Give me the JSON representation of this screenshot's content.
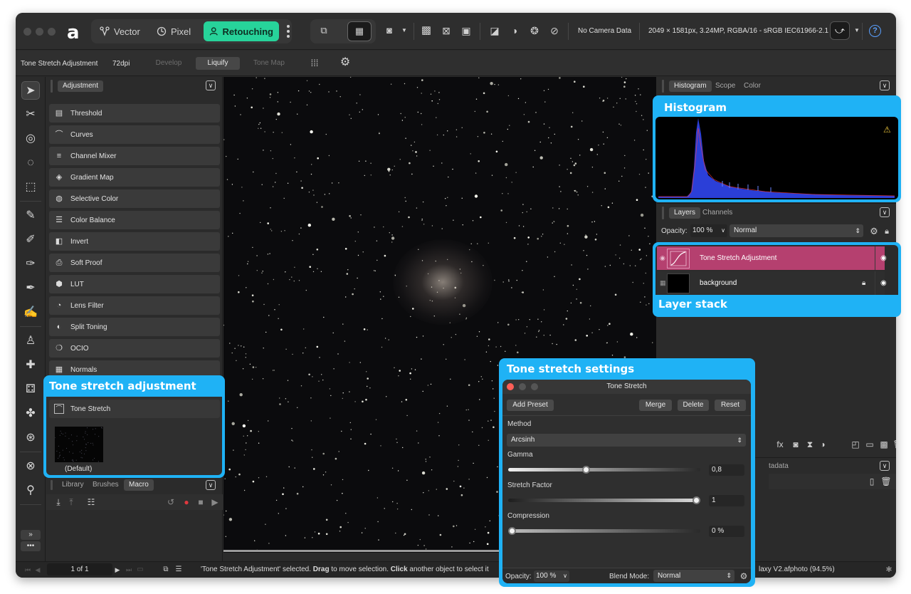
{
  "toolbar": {
    "personas": [
      {
        "label": "Vector",
        "icon": "vector-icon"
      },
      {
        "label": "Pixel",
        "icon": "pixel-icon"
      },
      {
        "label": "Retouching",
        "icon": "person-icon",
        "active": true
      }
    ],
    "camera_info": "No Camera Data",
    "document_info": "2049 × 1581px, 3.24MP, RGBA/16 - sRGB IEC61966-2.1",
    "help": "?"
  },
  "context": {
    "tool_name": "Tone Stretch Adjustment",
    "dpi": "72dpi",
    "buttons": [
      "Develop",
      "Liquify",
      "Tone Map"
    ],
    "active_button": "Liquify"
  },
  "adjustment_panel": {
    "tab": "Adjustment",
    "items": [
      {
        "label": "Threshold",
        "icon": "threshold-icon"
      },
      {
        "label": "Curves",
        "icon": "curves-icon"
      },
      {
        "label": "Channel Mixer",
        "icon": "channel-mixer-icon"
      },
      {
        "label": "Gradient Map",
        "icon": "gradient-map-icon"
      },
      {
        "label": "Selective Color",
        "icon": "selective-color-icon"
      },
      {
        "label": "Color Balance",
        "icon": "color-balance-icon"
      },
      {
        "label": "Invert",
        "icon": "invert-icon"
      },
      {
        "label": "Soft Proof",
        "icon": "printer-icon"
      },
      {
        "label": "LUT",
        "icon": "cube-icon"
      },
      {
        "label": "Lens Filter",
        "icon": "lens-filter-icon"
      },
      {
        "label": "Split Toning",
        "icon": "split-toning-icon"
      },
      {
        "label": "OCIO",
        "icon": "ocio-icon"
      },
      {
        "label": "Normals",
        "icon": "normals-icon"
      }
    ],
    "preset": {
      "label": "Tone Stretch",
      "default_label": "(Default)"
    }
  },
  "bottom_left_panel": {
    "tabs": [
      "Library",
      "Brushes",
      "Macro"
    ],
    "active_tab": "Macro"
  },
  "status": {
    "page": "1 of 1",
    "message_prefix": "'Tone Stretch Adjustment' selected. ",
    "message_drag": "Drag",
    "message_mid": " to move selection. ",
    "message_click": "Click",
    "message_suffix": " another object to select it",
    "filename": "laxy V2.afphoto (94.5%)"
  },
  "histogram_panel": {
    "tabs": [
      "Histogram",
      "Scope",
      "Color"
    ],
    "active_tab": "Histogram"
  },
  "layers_panel": {
    "tabs": [
      "Layers",
      "Channels"
    ],
    "active_tab": "Layers",
    "opacity_label": "Opacity:",
    "opacity_value": "100 %",
    "blend_mode": "Normal",
    "layers": [
      {
        "name": "Tone Stretch Adjustment",
        "selected": true
      },
      {
        "name": "background",
        "selected": false
      }
    ],
    "metadata_partial": "tadata"
  },
  "callouts": {
    "histogram": "Histogram",
    "layer_stack": "Layer stack",
    "tone_adjustment": "Tone stretch adjustment",
    "tone_settings": "Tone stretch settings"
  },
  "dialog": {
    "title": "Tone Stretch",
    "add_preset": "Add Preset",
    "merge": "Merge",
    "delete": "Delete",
    "reset": "Reset",
    "method_label": "Method",
    "method_value": "Arcsinh",
    "gamma_label": "Gamma",
    "gamma_value": "0,8",
    "gamma_fraction": 0.4,
    "stretch_label": "Stretch Factor",
    "stretch_value": "1",
    "stretch_fraction": 1.0,
    "compression_label": "Compression",
    "compression_value": "0 %",
    "compression_fraction": 0.0,
    "opacity_label": "Opacity:",
    "opacity_value": "100 %",
    "blend_label": "Blend Mode:",
    "blend_value": "Normal"
  },
  "colors": {
    "persona_active": "#27d39a",
    "callout": "#1fb2f5",
    "layer_selected": "#b5406f"
  }
}
